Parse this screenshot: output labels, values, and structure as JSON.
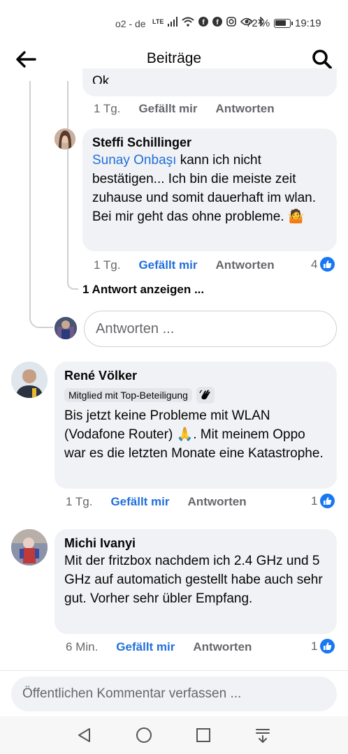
{
  "status_bar": {
    "carrier": "o2 - de",
    "network": "LTE",
    "battery_percent": "72 %",
    "time": "19:19"
  },
  "header": {
    "title": "Beiträge"
  },
  "comments": [
    {
      "partial_text": "Ok",
      "time": "1 Tg.",
      "like_label": "Gefällt mir",
      "reply_label": "Antworten"
    },
    {
      "author": "Steffi Schillinger",
      "mention": "Sunay Onbaşı",
      "text": " kann ich nicht bestätigen... Ich bin die meiste zeit zuhause und somit dauerhaft im wlan. Bei mir geht das ohne probleme. 🤷",
      "time": "1 Tg.",
      "like_label": "Gefällt mir",
      "reply_label": "Antworten",
      "reactions": "4"
    },
    {
      "author": "René Völker",
      "badge": "Mitglied mit Top-Beteiligung",
      "text": "Bis jetzt keine Probleme mit WLAN (Vodafone Router) 🙏. Mit meinem Oppo war es die letzten Monate eine Katastrophe.",
      "time": "1 Tg.",
      "like_label": "Gefällt mir",
      "reply_label": "Antworten",
      "reactions": "1"
    },
    {
      "author": "Michi Ivanyi",
      "text": "Mit der fritzbox nachdem ich 2.4 GHz und 5 GHz auf automatich gestellt habe auch sehr gut. Vorher sehr übler Empfang.",
      "time": "6 Min.",
      "like_label": "Gefällt mir",
      "reply_label": "Antworten",
      "reactions": "1"
    }
  ],
  "thread": {
    "show_replies": "1 Antwort anzeigen ...",
    "reply_placeholder": "Antworten ..."
  },
  "composer": {
    "placeholder": "Öffentlichen Kommentar verfassen ..."
  },
  "colors": {
    "accent": "#216fdb",
    "like_blue": "#1877f2",
    "bubble": "#f0f2f5"
  }
}
